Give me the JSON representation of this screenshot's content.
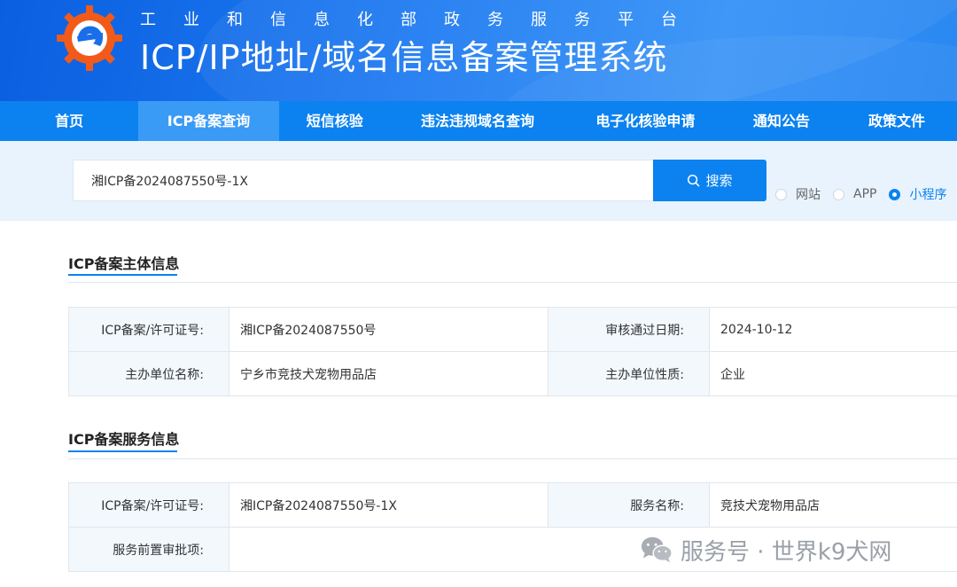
{
  "header": {
    "subtitle": "工业和信息化部政务服务平台",
    "title": "ICP/IP地址/域名信息备案管理系统"
  },
  "nav": {
    "items": [
      {
        "label": "首页",
        "active": false
      },
      {
        "label": "ICP备案查询",
        "active": true
      },
      {
        "label": "短信核验",
        "active": false
      },
      {
        "label": "违法违规域名查询",
        "active": false
      },
      {
        "label": "电子化核验申请",
        "active": false
      },
      {
        "label": "通知公告",
        "active": false
      },
      {
        "label": "政策文件",
        "active": false
      }
    ]
  },
  "search": {
    "value": "湘ICP备2024087550号-1X",
    "button_label": "搜索",
    "options": [
      {
        "label": "网站",
        "checked": false
      },
      {
        "label": "APP",
        "checked": false
      },
      {
        "label": "小程序",
        "checked": true
      }
    ]
  },
  "subject_section": {
    "title": "ICP备案主体信息",
    "rows": [
      {
        "label1": "ICP备案/许可证号:",
        "value1": "湘ICP备2024087550号",
        "label2": "审核通过日期:",
        "value2": "2024-10-12"
      },
      {
        "label1": "主办单位名称:",
        "value1": "宁乡市竞技犬宠物用品店",
        "label2": "主办单位性质:",
        "value2": "企业"
      }
    ]
  },
  "service_section": {
    "title": "ICP备案服务信息",
    "rows": [
      {
        "label1": "ICP备案/许可证号:",
        "value1": "湘ICP备2024087550号-1X",
        "label2": "服务名称:",
        "value2": "竞技犬宠物用品店"
      },
      {
        "label1": "服务前置审批项:",
        "value1": "",
        "label2": "",
        "value2": ""
      }
    ]
  },
  "watermark": {
    "text": "服务号 · 世界k9犬网"
  },
  "colors": {
    "primary": "#0b82f0",
    "nav_active": "#3a9bf6",
    "search_band": "#e8f3fd",
    "label_bg": "#f3f8fd",
    "logo_orange": "#f25a1a"
  }
}
